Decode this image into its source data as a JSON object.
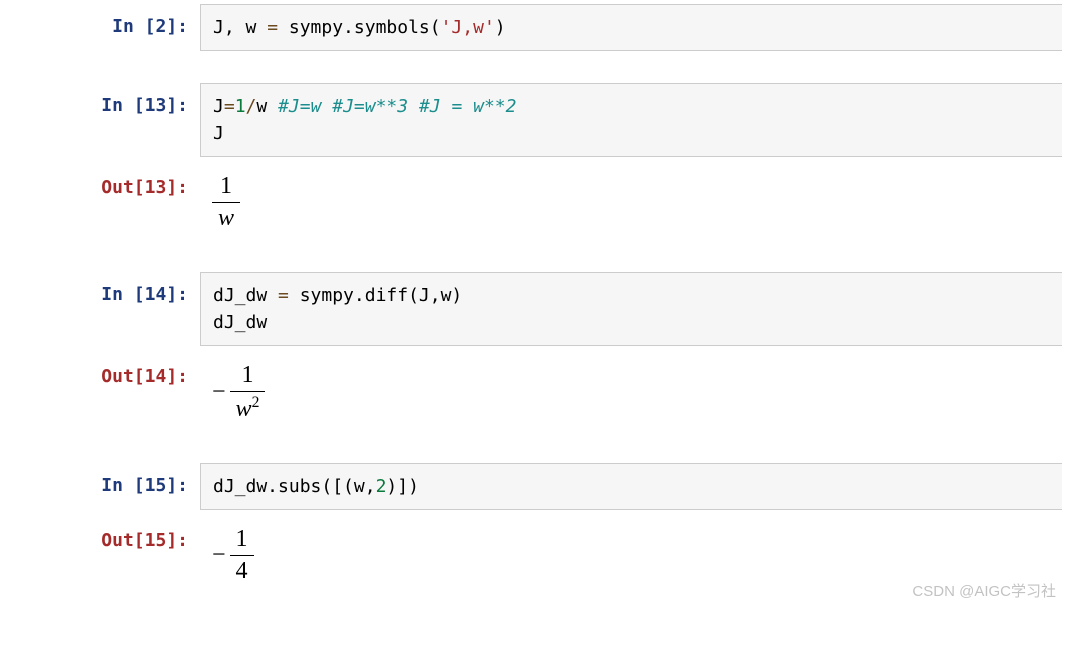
{
  "cells": {
    "c2": {
      "promptIn": "In [2]:",
      "code": {
        "l1": "J, w = sympy.symbols('J,w')"
      }
    },
    "c13": {
      "promptIn": "In [13]:",
      "code": {
        "l1a": "J=",
        "l1num": "1",
        "l1b": "/w ",
        "l1comment": "#J=w #J=w**3 #J = w**2",
        "l2": "J"
      },
      "promptOut": "Out[13]:",
      "output": {
        "num": "1",
        "den": "w"
      }
    },
    "c14": {
      "promptIn": "In [14]:",
      "code": {
        "l1": "dJ_dw = sympy.diff(J,w)",
        "l2": "dJ_dw"
      },
      "promptOut": "Out[14]:",
      "output": {
        "minus": "−",
        "num": "1",
        "denVar": "w",
        "denExp": "2"
      }
    },
    "c15": {
      "promptIn": "In [15]:",
      "code": {
        "l1a": "dJ_dw.subs([(w,",
        "l1num": "2",
        "l1b": ")])"
      },
      "promptOut": "Out[15]:",
      "output": {
        "minus": "−",
        "num": "1",
        "den": "4"
      }
    }
  },
  "watermark": "CSDN @AIGC学习社"
}
